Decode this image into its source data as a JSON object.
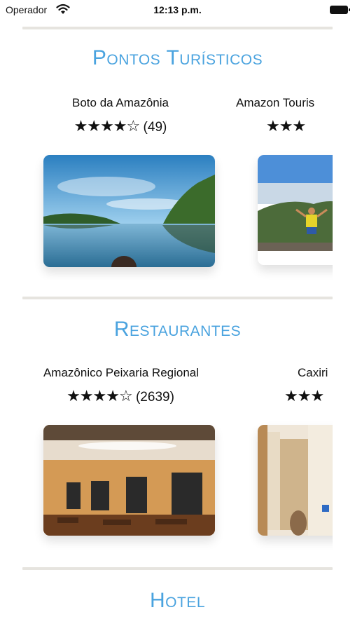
{
  "status_bar": {
    "carrier": "Operador",
    "time": "12:13 p.m.",
    "wifi_icon": "wifi-icon",
    "battery_icon": "battery-icon"
  },
  "sections": {
    "pontos": {
      "title": "Pontos Turísticos",
      "cards": [
        {
          "name": "Boto da Amazônia",
          "stars": "★★★★☆",
          "reviews": "(49)",
          "image": "river-landscape"
        },
        {
          "name": "Amazon Touris",
          "stars": "★★★",
          "reviews": "",
          "image": "mountain-hiker"
        }
      ]
    },
    "restaurantes": {
      "title": "Restaurantes",
      "cards": [
        {
          "name": "Amazônico Peixaria Regional",
          "stars": "★★★★☆",
          "reviews": "(2639)",
          "image": "restaurant-dining-room"
        },
        {
          "name": "Caxiri",
          "stars": "★★★",
          "reviews": "",
          "image": "restaurant-interior"
        }
      ]
    },
    "hotel": {
      "title": "Hotel"
    }
  },
  "colors": {
    "section_title": "#4aa3df",
    "divider": "#e6e4df"
  }
}
